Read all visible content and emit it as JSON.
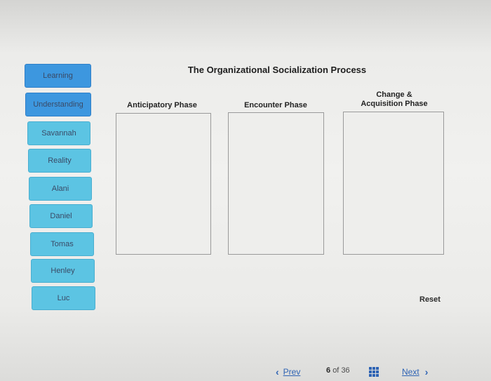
{
  "title": "The Organizational Socialization Process",
  "items": [
    {
      "label": "Learning"
    },
    {
      "label": "Understanding"
    },
    {
      "label": "Savannah"
    },
    {
      "label": "Reality"
    },
    {
      "label": "Alani"
    },
    {
      "label": "Daniel"
    },
    {
      "label": "Tomas"
    },
    {
      "label": "Henley"
    },
    {
      "label": "Luc"
    }
  ],
  "columns": [
    {
      "line1": "Anticipatory Phase",
      "line2": ""
    },
    {
      "line1": "Encounter Phase",
      "line2": ""
    },
    {
      "line1": "Change &",
      "line2": "Acquisition Phase"
    }
  ],
  "reset_label": "Reset",
  "nav": {
    "prev_label": "Prev",
    "next_label": "Next",
    "current": "6",
    "of_label": "of",
    "total": "36"
  },
  "icons": {
    "prev": "chevron-left-icon",
    "next": "chevron-right-icon",
    "grid": "grid-icon"
  },
  "colors": {
    "chip_dark": "#3d97df",
    "chip_light": "#5cc4e3",
    "link": "#2f64b4"
  }
}
